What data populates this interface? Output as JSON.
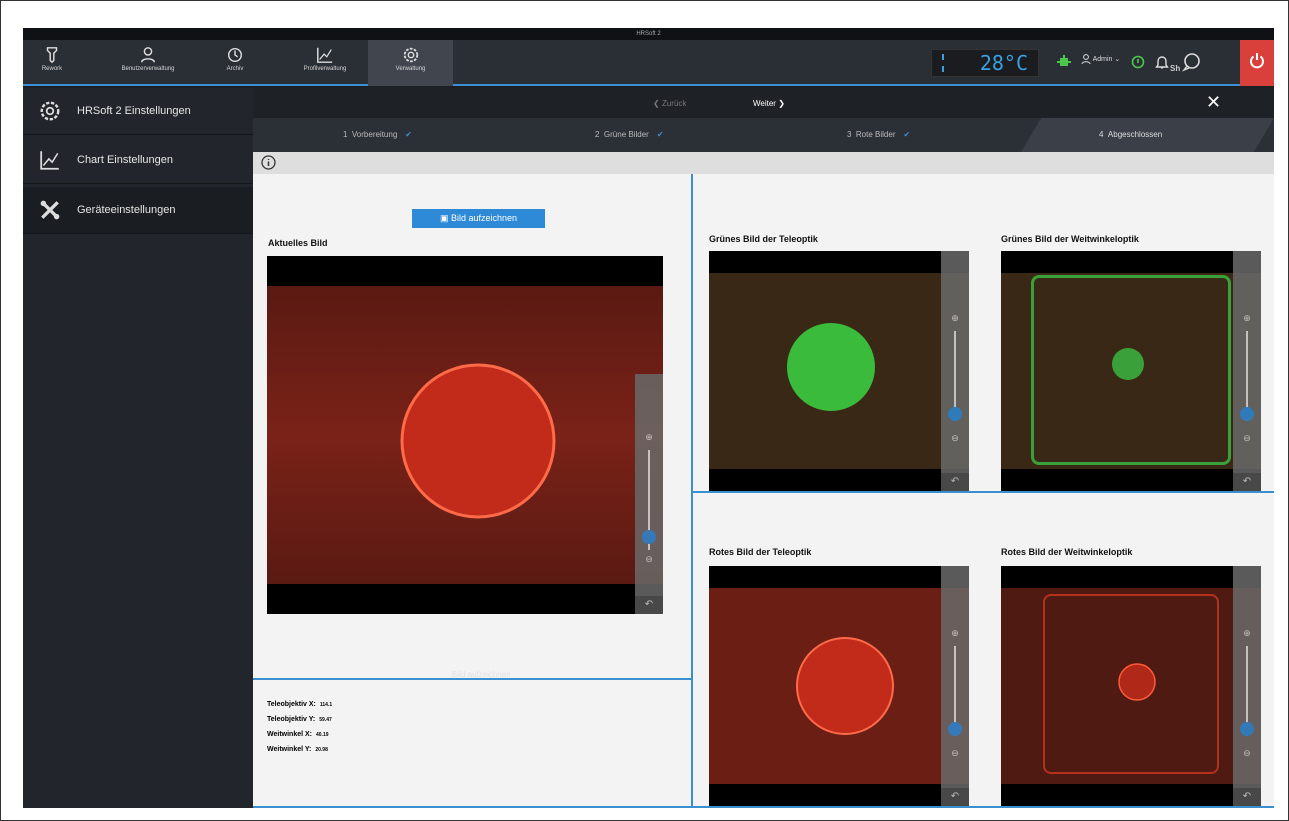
{
  "window": {
    "title": "HRSoft 2"
  },
  "toolbar": {
    "items": [
      {
        "label": "Rework",
        "icon": "rework-icon"
      },
      {
        "label": "Benutzerverwaltung",
        "icon": "users-icon"
      },
      {
        "label": "Archiv",
        "icon": "history-icon"
      },
      {
        "label": "Profilverwaltung",
        "icon": "chart-icon"
      },
      {
        "label": "Verwaltung",
        "icon": "gear-icon"
      }
    ],
    "temperature": "28°C",
    "user": "Admin",
    "status_text": "Sh"
  },
  "sidebar": {
    "items": [
      {
        "label": "HRSoft 2 Einstellungen",
        "icon": "gear-icon"
      },
      {
        "label": "Chart Einstellungen",
        "icon": "chart-icon"
      },
      {
        "label": "Geräteeinstellungen",
        "icon": "tools-icon"
      }
    ]
  },
  "wizard": {
    "back": "Zurück",
    "next": "Weiter",
    "steps": [
      {
        "num": "1",
        "label": "Vorbereitung"
      },
      {
        "num": "2",
        "label": "Grüne Bilder"
      },
      {
        "num": "3",
        "label": "Rote Bilder"
      },
      {
        "num": "4",
        "label": "Abgeschlossen"
      }
    ]
  },
  "main": {
    "record_button": "Bild aufzeichnen",
    "record_button_ghost": "Bild aufzeichnen",
    "current_title": "Aktuelles Bild",
    "green_tele": "Grünes Bild der Teleoptik",
    "green_wide": "Grünes Bild der Weitwinkeloptik",
    "red_tele": "Rotes Bild der Teleoptik",
    "red_wide": "Rotes Bild der Weitwinkeloptik",
    "coords": [
      {
        "label": "Teleobjektiv X:",
        "value": "114.1"
      },
      {
        "label": "Teleobjektiv Y:",
        "value": "59.47"
      },
      {
        "label": "Weitwinkel X:",
        "value": "40.19"
      },
      {
        "label": "Weitwinkel Y:",
        "value": "20.98"
      }
    ]
  },
  "colors": {
    "accent": "#3a8fd0",
    "power": "#d9403b",
    "green_ok": "#4bc94b"
  }
}
